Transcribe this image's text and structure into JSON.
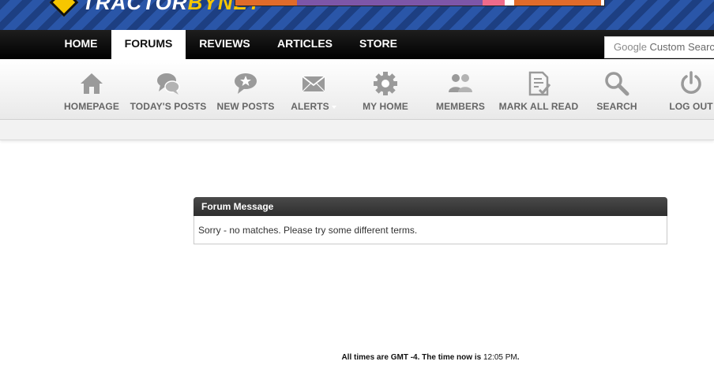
{
  "brand": {
    "logo_white": "TRACTOR",
    "logo_yellow": "BYNET",
    "icon": "tractor-diamond-icon",
    "colors": {
      "banner": "#234a94",
      "logo_yellow": "#f6c600"
    }
  },
  "main_nav": [
    {
      "label": "HOME",
      "active": false
    },
    {
      "label": "FORUMS",
      "active": true
    },
    {
      "label": "REVIEWS",
      "active": false
    },
    {
      "label": "ARTICLES",
      "active": false
    },
    {
      "label": "STORE",
      "active": false
    }
  ],
  "search": {
    "brand": "Google",
    "placeholder": "Custom Search"
  },
  "icon_bar": [
    {
      "label": "HOMEPAGE",
      "icon": "house-icon"
    },
    {
      "label": "TODAY'S POSTS",
      "icon": "chat-bubbles-icon"
    },
    {
      "label": "NEW POSTS",
      "icon": "chat-star-icon"
    },
    {
      "label": "ALERTS",
      "icon": "envelope-icon"
    },
    {
      "label": "MY HOME",
      "icon": "gear-icon"
    },
    {
      "label": "MEMBERS",
      "icon": "users-icon"
    },
    {
      "label": "MARK ALL READ",
      "icon": "document-check-icon"
    },
    {
      "label": "SEARCH",
      "icon": "magnifier-icon"
    },
    {
      "label": "LOG OUT",
      "icon": "power-icon"
    }
  ],
  "message": {
    "title": "Forum Message",
    "body": "Sorry - no matches. Please try some different terms."
  },
  "footer": {
    "prefix": "All times are GMT -4. The time now is",
    "time": "12:05 PM",
    "suffix": "."
  },
  "colors": {
    "icon_gray": "#9a9a9a",
    "label_gray": "#666666",
    "nav_bg": "#000000"
  }
}
